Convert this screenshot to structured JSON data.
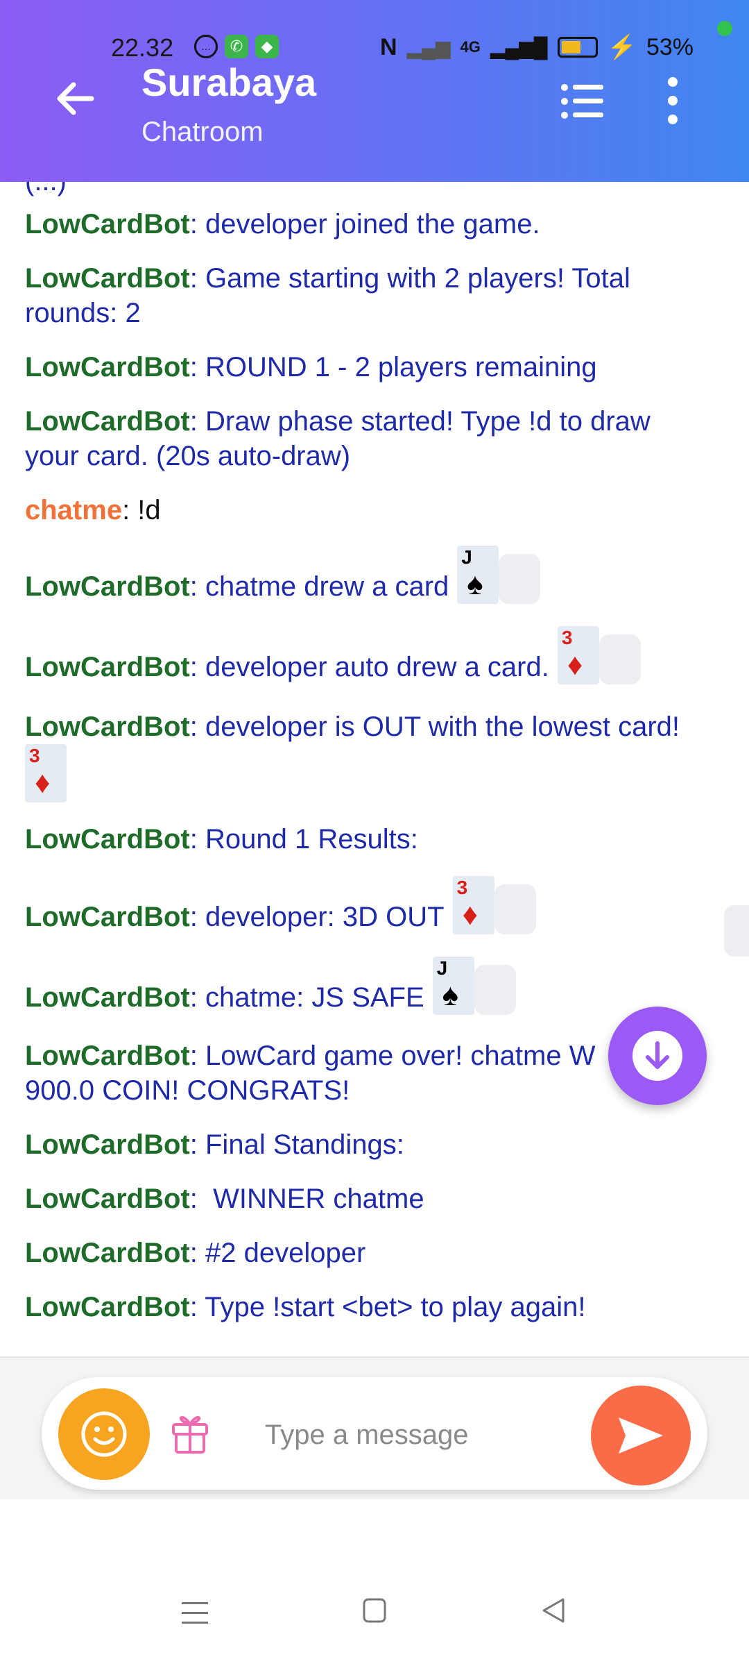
{
  "status_bar": {
    "time": "22.32",
    "battery": "53%",
    "network": "4G"
  },
  "header": {
    "title": "Surabaya",
    "subtitle": "Chatroom",
    "back_icon": "arrow-left-icon",
    "list_icon": "list-icon",
    "more_icon": "more-vertical-icon"
  },
  "partial_top": "(...)",
  "messages": [
    {
      "sender": "LowCardBot",
      "text": "developer joined the game."
    },
    {
      "sender": "LowCardBot",
      "text": "Game starting with 2 players! Total rounds: 2"
    },
    {
      "sender": "LowCardBot",
      "text": "ROUND 1 - 2 players remaining"
    },
    {
      "sender": "LowCardBot",
      "text": "Draw phase started! Type !d to draw your card. (20s auto-draw)"
    },
    {
      "sender": "chatme",
      "text": "!d"
    },
    {
      "sender": "LowCardBot",
      "text": "chatme drew a card",
      "card": {
        "rank": "J",
        "suit": "♠"
      }
    },
    {
      "sender": "LowCardBot",
      "text": "developer auto drew a card.",
      "card": {
        "rank": "3",
        "suit": "♦"
      }
    },
    {
      "sender": "LowCardBot",
      "text": "developer is OUT with the lowest card!",
      "card": {
        "rank": "3",
        "suit": "♦"
      }
    },
    {
      "sender": "LowCardBot",
      "text": "Round 1 Results:"
    },
    {
      "sender": "LowCardBot",
      "text": "developer: 3D OUT",
      "card": {
        "rank": "3",
        "suit": "♦"
      }
    },
    {
      "sender": "LowCardBot",
      "text": "chatme: JS SAFE",
      "card": {
        "rank": "J",
        "suit": "♠"
      }
    },
    {
      "sender": "LowCardBot",
      "text": "LowCard game over! chatme W",
      "text2": "900.0 COIN! CONGRATS!"
    },
    {
      "sender": "LowCardBot",
      "text": "Final Standings:"
    },
    {
      "sender": "LowCardBot",
      "text": " WINNER chatme"
    },
    {
      "sender": "LowCardBot",
      "text": "#2 developer"
    },
    {
      "sender": "LowCardBot",
      "text": "Type !start <bet> to play again!"
    }
  ],
  "separator": ": ",
  "input": {
    "placeholder": "Type a message",
    "value": ""
  },
  "colors": {
    "bot_sender": "#1e6b2a",
    "user_sender": "#f07238",
    "message_text": "#1e2aa8",
    "emoji_button": "#f7a520",
    "send_button": "#fb6b47",
    "scroll_button": "#9b59f6"
  }
}
